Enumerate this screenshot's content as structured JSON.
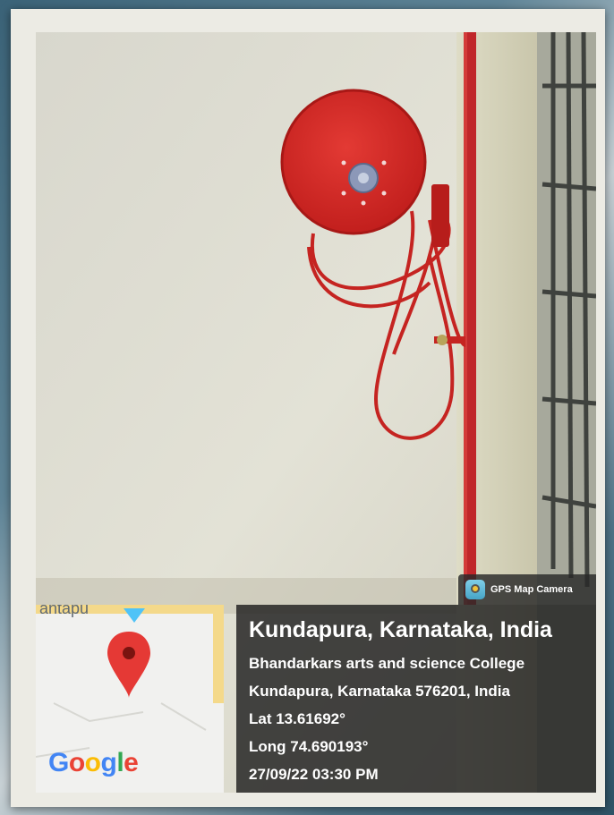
{
  "overlay": {
    "app_name": "GPS Map Camera",
    "location_title": "Kundapura, Karnataka, India",
    "address_line1": "Bhandarkars arts and science College",
    "address_line2": "Kundapura, Karnataka 576201, India",
    "latitude": "Lat 13.61692°",
    "longitude": "Long 74.690193°",
    "datetime": "27/09/22 03:30 PM"
  },
  "map": {
    "partial_label": "antapu",
    "brand": "Google",
    "pin_color": "#e53935",
    "marker_color": "#4fc3f7"
  },
  "colors": {
    "hose_reel": "#d52a27",
    "wall": "#ddddd1",
    "pipe": "#c0262a"
  },
  "scene": {
    "icons": [
      "camera-app-icon",
      "map-pin-icon",
      "hose-reel"
    ]
  }
}
